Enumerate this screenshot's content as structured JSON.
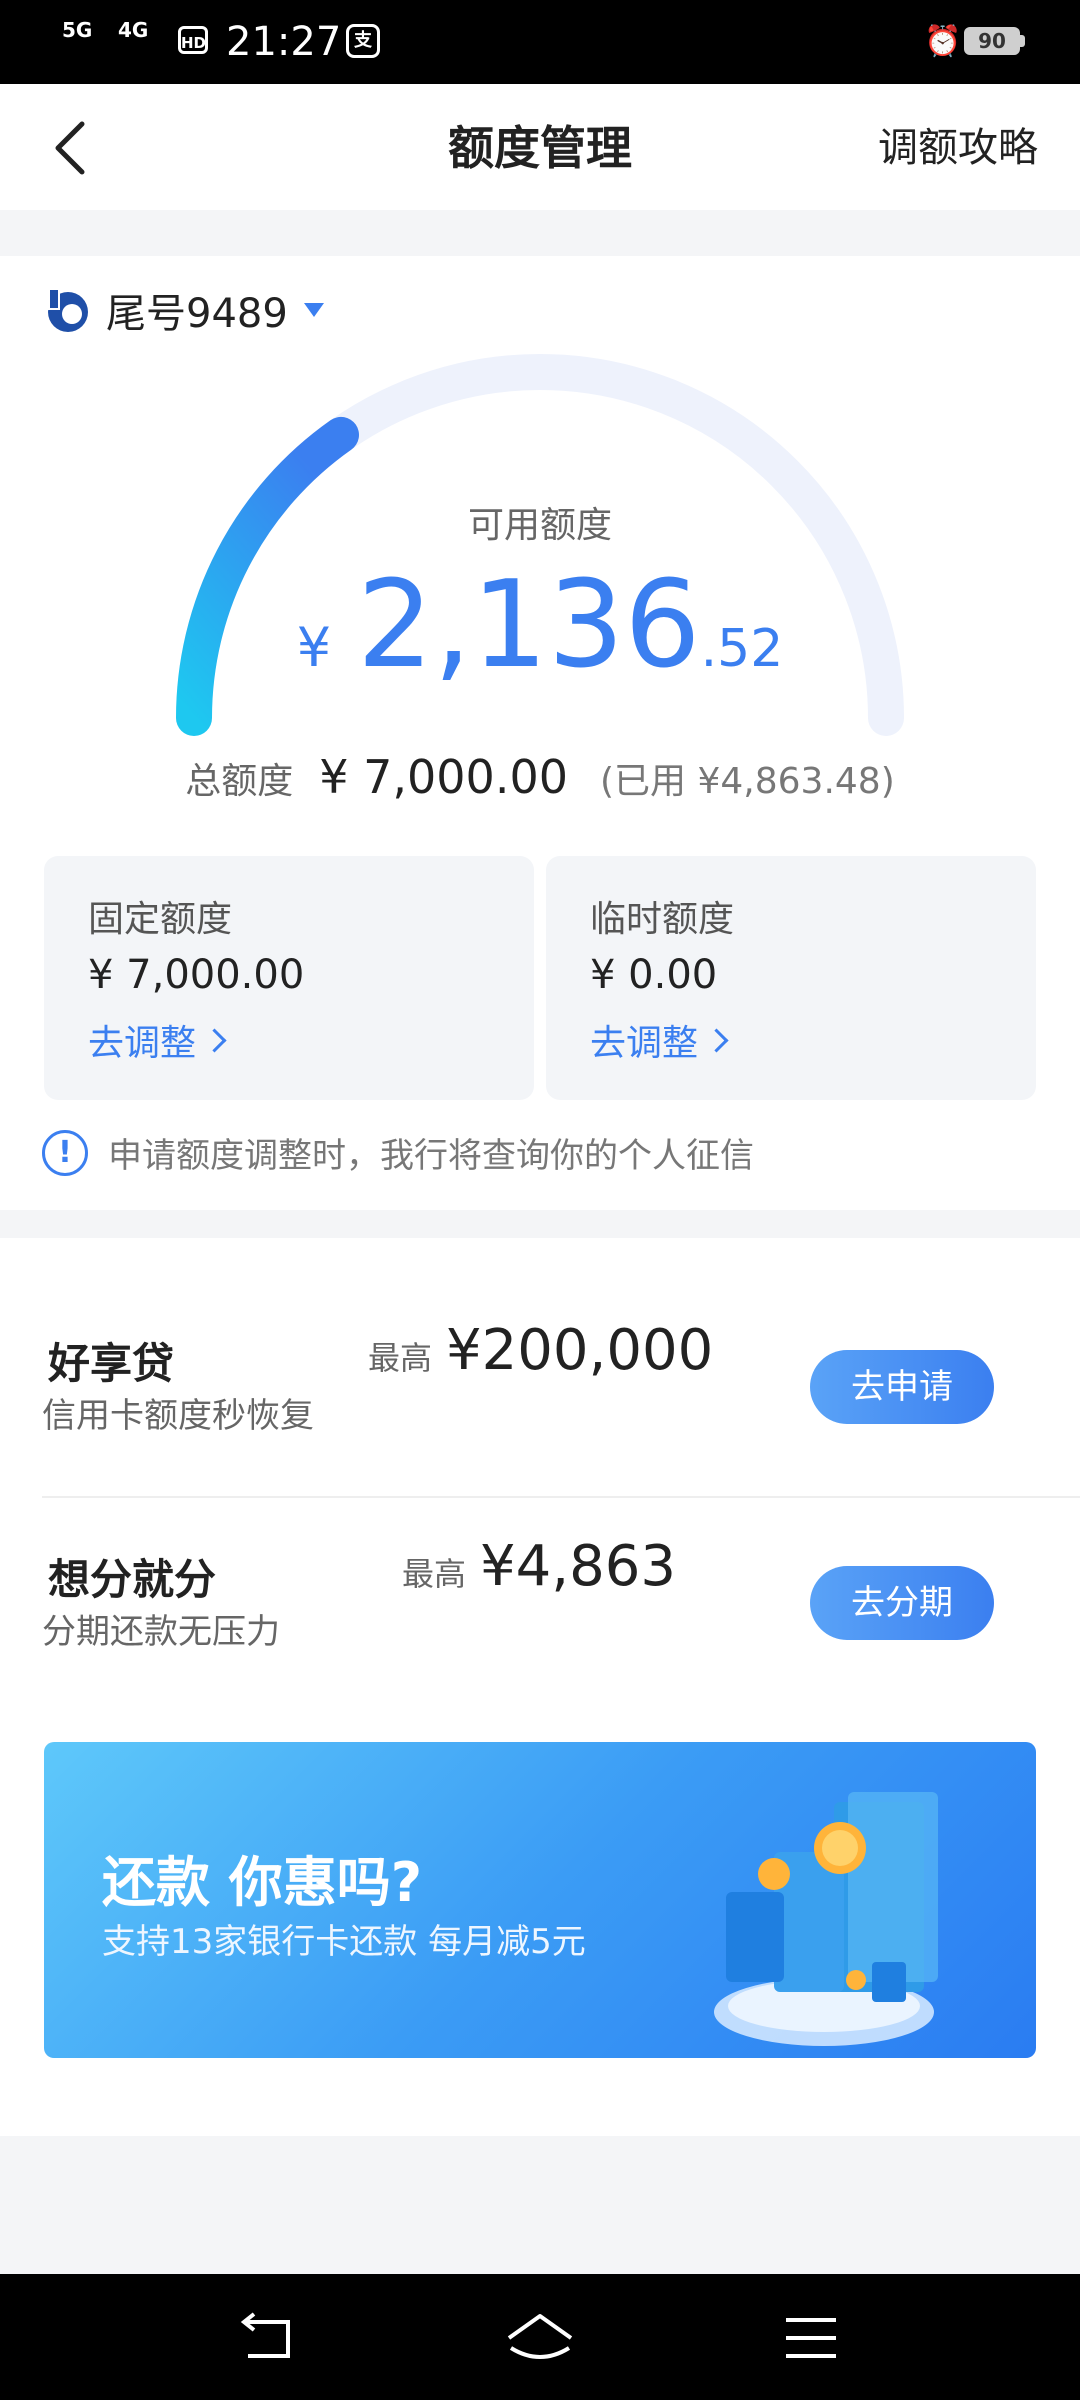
{
  "status_bar": {
    "network1": "5G",
    "network2": "4G",
    "hd": "HD",
    "time": "21:27",
    "app_icon": "支",
    "battery": "90"
  },
  "nav": {
    "title": "额度管理",
    "right_link": "调额攻略"
  },
  "card": {
    "label": "尾号9489"
  },
  "available": {
    "label": "可用额度",
    "currency": "¥",
    "integer": "2,136",
    "decimal": ".52",
    "gauge_fraction": 0.305
  },
  "total": {
    "label": "总额度",
    "value": "¥ 7,000.00",
    "used": "(已用 ¥4,863.48)"
  },
  "fixed": {
    "title": "固定额度",
    "value": "¥ 7,000.00",
    "action": "去调整"
  },
  "temporary": {
    "title": "临时额度",
    "value": "¥ 0.00",
    "action": "去调整"
  },
  "notice": {
    "icon": "!",
    "text": "申请额度调整时，我行将查询你的个人征信"
  },
  "products": [
    {
      "name": "好享贷",
      "subtitle": "信用卡额度秒恢复",
      "max_label": "最高",
      "max_value": "¥200,000",
      "button": "去申请"
    },
    {
      "name": "想分就分",
      "subtitle": "分期还款无压力",
      "max_label": "最高",
      "max_value": "¥4,863",
      "button": "去分期"
    }
  ],
  "banner": {
    "headline": "还款 你惠吗?",
    "subline": "支持13家银行卡还款 每月减5元"
  },
  "colors": {
    "accent": "#3b7ff0",
    "gauge_start": "#1ec8f0",
    "gauge_track": "#eef2fc"
  }
}
